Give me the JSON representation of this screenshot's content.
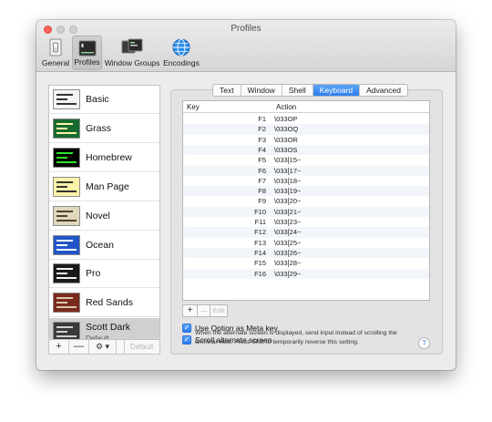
{
  "window": {
    "title": "Profiles"
  },
  "toolbar": {
    "items": [
      {
        "label": "General",
        "icon": "light-switch-icon"
      },
      {
        "label": "Profiles",
        "icon": "terminal-icon",
        "selected": true
      },
      {
        "label": "Window Groups",
        "icon": "window-groups-icon"
      },
      {
        "label": "Encodings",
        "icon": "globe-icon"
      }
    ]
  },
  "profiles": [
    {
      "name": "Basic",
      "bg": "#f4f4f4",
      "fg": "#333333"
    },
    {
      "name": "Grass",
      "bg": "#176b2f",
      "fg": "#fff2a8"
    },
    {
      "name": "Homebrew",
      "bg": "#000000",
      "fg": "#29e329"
    },
    {
      "name": "Man Page",
      "bg": "#fdf3a9",
      "fg": "#333333"
    },
    {
      "name": "Novel",
      "bg": "#dfd8bd",
      "fg": "#53402b"
    },
    {
      "name": "Ocean",
      "bg": "#2255c8",
      "fg": "#ffffff"
    },
    {
      "name": "Pro",
      "bg": "#1a1a1a",
      "fg": "#f2f2f2"
    },
    {
      "name": "Red Sands",
      "bg": "#7a2a1d",
      "fg": "#d8c9a7"
    },
    {
      "name": "Scott Dark",
      "bg": "#3a3a3a",
      "fg": "#cfcfcf",
      "subtitle": "Default",
      "selected": true
    }
  ],
  "list_buttons": {
    "add": "+",
    "remove": "—",
    "gear": "⚙ ▾",
    "default": "Default"
  },
  "tabs": [
    {
      "label": "Text"
    },
    {
      "label": "Window"
    },
    {
      "label": "Shell"
    },
    {
      "label": "Keyboard",
      "active": true
    },
    {
      "label": "Advanced"
    }
  ],
  "key_table": {
    "headers": {
      "key": "Key",
      "action": "Action"
    },
    "rows": [
      {
        "key": "F1",
        "action": "\\033OP"
      },
      {
        "key": "F2",
        "action": "\\033OQ"
      },
      {
        "key": "F3",
        "action": "\\033OR"
      },
      {
        "key": "F4",
        "action": "\\033OS"
      },
      {
        "key": "F5",
        "action": "\\033[15~"
      },
      {
        "key": "F6",
        "action": "\\033[17~"
      },
      {
        "key": "F7",
        "action": "\\033[18~"
      },
      {
        "key": "F8",
        "action": "\\033[19~"
      },
      {
        "key": "F9",
        "action": "\\033[20~"
      },
      {
        "key": "F10",
        "action": "\\033[21~"
      },
      {
        "key": "F11",
        "action": "\\033[23~"
      },
      {
        "key": "F12",
        "action": "\\033[24~"
      },
      {
        "key": "F13",
        "action": "\\033[25~"
      },
      {
        "key": "F14",
        "action": "\\033[26~"
      },
      {
        "key": "F15",
        "action": "\\033[28~"
      },
      {
        "key": "F16",
        "action": "\\033[29~"
      }
    ]
  },
  "table_buttons": {
    "add": "+",
    "remove": "—",
    "edit": "Edit"
  },
  "options": {
    "meta_key": {
      "label": "Use Option as Meta key",
      "checked": true
    },
    "scroll_alt": {
      "label": "Scroll alternate screen",
      "checked": true
    },
    "hint": "When the alternate screen is displayed, send input instead of scrolling the terminal view. Press Shift to temporarily reverse this setting."
  },
  "help": "?"
}
